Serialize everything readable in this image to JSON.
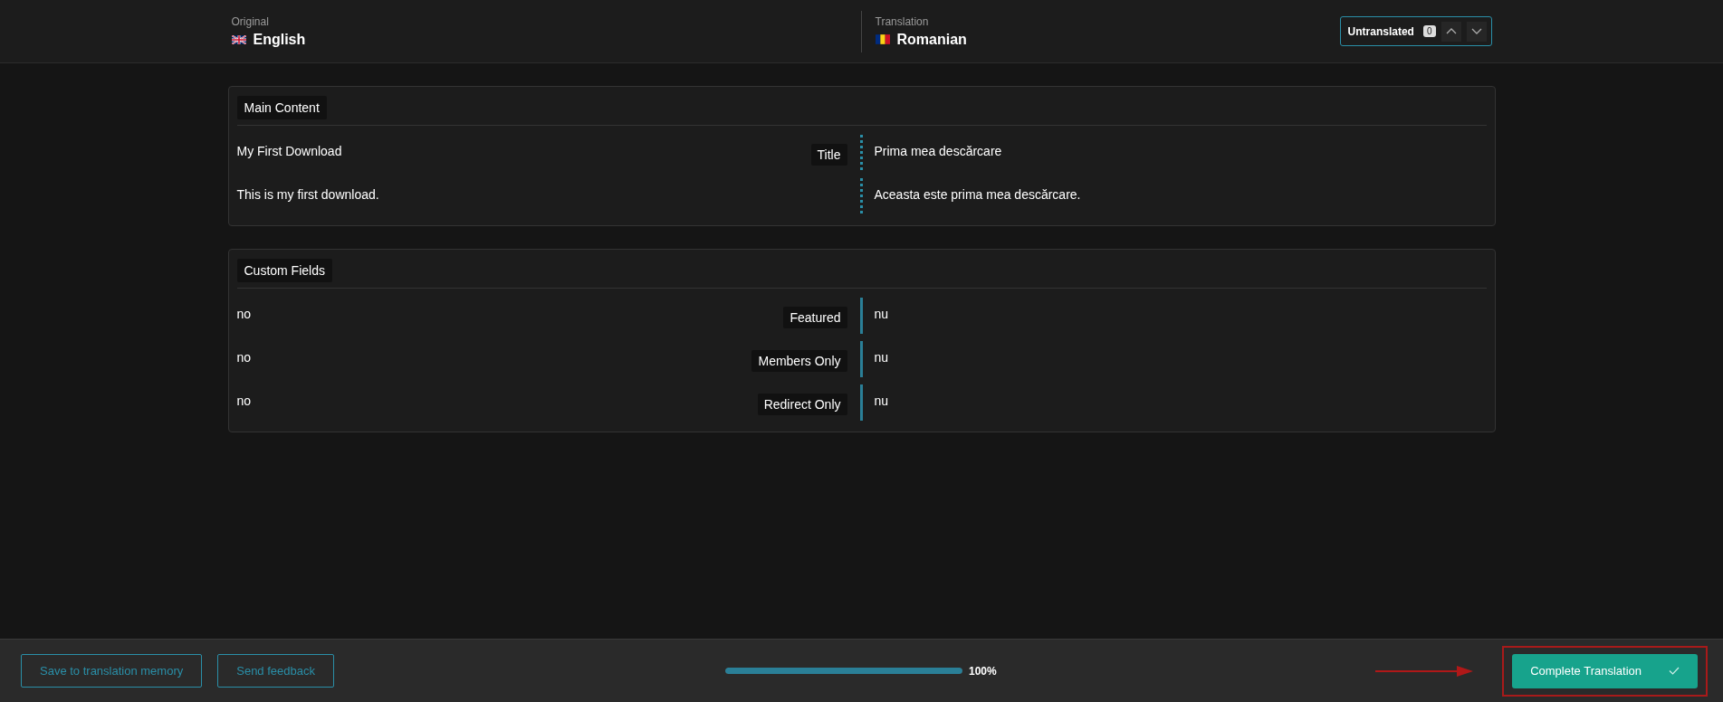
{
  "header": {
    "original": {
      "caption": "Original",
      "language": "English"
    },
    "translation": {
      "caption": "Translation",
      "language": "Romanian"
    },
    "filter": {
      "label": "Untranslated",
      "count": "0"
    }
  },
  "sections": [
    {
      "title": "Main Content",
      "rows": [
        {
          "kind": "long_text",
          "source": "My First Download",
          "label": "Title",
          "target": "Prima mea descărcare"
        },
        {
          "kind": "long_text",
          "source": "This is my first download.",
          "target": "Aceasta este prima mea descărcare."
        }
      ]
    },
    {
      "title": "Custom Fields",
      "rows": [
        {
          "kind": "short_text",
          "source": "no",
          "label": "Featured",
          "target": "nu"
        },
        {
          "kind": "short_text",
          "source": "no",
          "label": "Members Only",
          "target": "nu"
        },
        {
          "kind": "short_text",
          "source": "no",
          "label": "Redirect Only",
          "target": "nu"
        }
      ]
    }
  ],
  "footer": {
    "buttons": [
      "Save to translation memory",
      "Send feedback"
    ],
    "progress": {
      "level": 1,
      "reading": "100%"
    },
    "complete_button": "Complete Translation"
  }
}
